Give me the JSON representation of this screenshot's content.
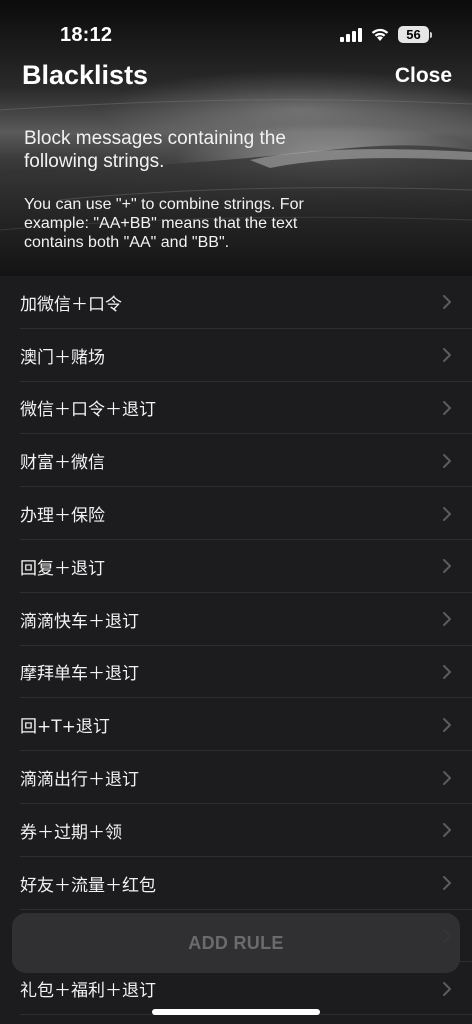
{
  "status": {
    "time": "18:12",
    "battery": "56"
  },
  "header": {
    "title": "Blacklists",
    "close_label": "Close",
    "intro": "Block messages containing the following strings.",
    "hint": "You can use \"+\" to combine strings. For example: \"AA+BB\" means that the text contains both \"AA\" and \"BB\"."
  },
  "rules": [
    "加微信＋口令",
    "澳门＋赌场",
    "微信＋口令＋退订",
    "财富＋微信",
    "办理＋保险",
    "回复＋退订",
    "滴滴快车＋退订",
    "摩拜单车＋退订",
    "回+T+退订",
    "滴滴出行＋退订",
    "券＋过期＋领",
    "好友＋流量＋红包",
    "",
    "礼包＋福利＋退订"
  ],
  "footer": {
    "add_rule_label": "ADD RULE"
  },
  "icons": {
    "chevron": "chevron-right-icon",
    "signal": "signal-icon",
    "wifi": "wifi-icon",
    "battery": "battery-icon"
  }
}
